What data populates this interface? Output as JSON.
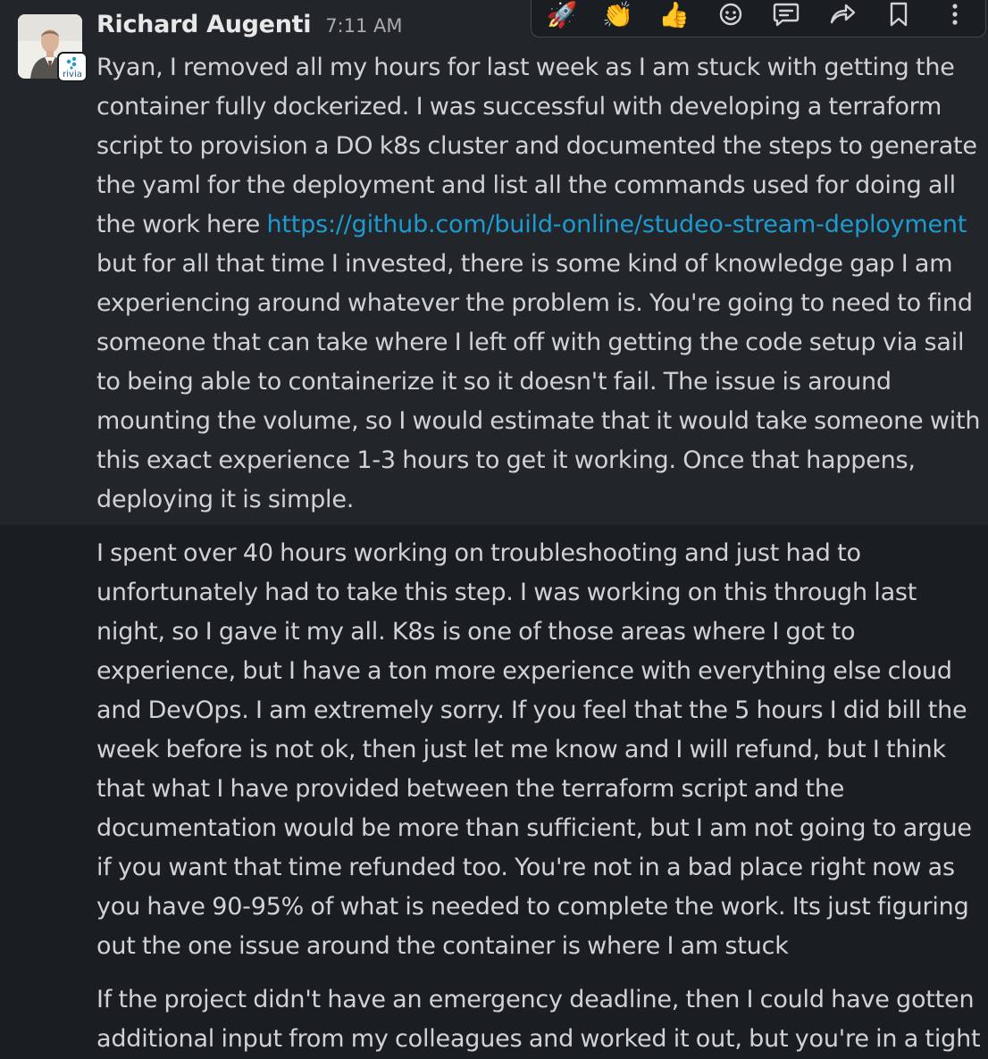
{
  "message": {
    "author": "Richard Augenti",
    "timestamp": "7:11 AM",
    "org_badge_label": "rivia",
    "paragraphs": [
      {
        "lines": [
          {
            "text": "Ryan, I removed all my hours for last week as I am stuck with getting the"
          },
          {
            "text": "container fully dockerized. I was successful with developing a terraform"
          },
          {
            "text": "script to provision a DO k8s cluster and documented the steps to generate"
          },
          {
            "text": "the yaml for the deployment and list all the commands used for doing all"
          },
          {
            "text": "the work here ",
            "link": "https://github.com/build-online/studeo-stream-deployment"
          },
          {
            "text": "but for all that time I invested, there is some kind of knowledge gap I am"
          },
          {
            "text": "experiencing around whatever the problem is. You're going to need to find"
          },
          {
            "text": "someone that can take where I left off with getting the code setup via sail"
          },
          {
            "text": "to being able to containerize it so it doesn't fail. The issue is around"
          },
          {
            "text": "mounting the volume, so I would estimate that it would take someone with"
          },
          {
            "text": "this exact experience 1-3 hours to get it working. Once that happens,"
          },
          {
            "text": "deploying it is simple."
          }
        ]
      },
      {
        "lines": [
          {
            "text": "I spent over 40 hours working on troubleshooting and just had to"
          },
          {
            "text": "unfortunately had to take this step. I was working on this through last"
          },
          {
            "text": "night, so I gave it my all. K8s is one of those areas where I got to"
          },
          {
            "text": "experience, but I have a ton more experience with everything else cloud"
          },
          {
            "text": "and DevOps. I am extremely sorry. If you feel that the 5 hours I did bill the"
          },
          {
            "text": "week before is not ok, then just let me know and I will refund, but I think"
          },
          {
            "text": "that what I have provided between the terraform script and the"
          },
          {
            "text": "documentation would be more than sufficient, but I am not going to argue"
          },
          {
            "text": "if you want that time refunded too. You're not in a bad place right now as"
          },
          {
            "text": "you have 90-95% of what is needed to complete the work. Its just figuring"
          },
          {
            "text": "out the one issue around the container is where I am stuck"
          }
        ]
      },
      {
        "lines": [
          {
            "text": "If the project didn't have an emergency deadline, then I could have gotten"
          },
          {
            "text": "additional input from my colleagues and worked it out, but you're in a tight"
          }
        ]
      }
    ]
  },
  "toolbar": {
    "items": [
      {
        "name": "rocket-emoji-reaction",
        "icon": "rocket-icon",
        "glyph": "🚀"
      },
      {
        "name": "clap-emoji-reaction",
        "icon": "clapping-hands-icon",
        "glyph": "👏"
      },
      {
        "name": "thumbs-up-emoji-reaction",
        "icon": "thumbs-up-icon",
        "glyph": "👍"
      },
      {
        "name": "add-reaction-button",
        "icon": "smiley-add-icon"
      },
      {
        "name": "reply-in-thread-button",
        "icon": "thread-bubble-icon"
      },
      {
        "name": "share-message-button",
        "icon": "forward-arrow-icon"
      },
      {
        "name": "save-for-later-button",
        "icon": "bookmark-icon"
      },
      {
        "name": "more-actions-button",
        "icon": "vertical-ellipsis-icon"
      }
    ]
  },
  "colors": {
    "background": "#1a1d21",
    "hover_background": "#222529",
    "text": "#d1d2d3",
    "author": "#e8e8e8",
    "timestamp": "#ababad",
    "link": "#1d9bd1",
    "toolbar_border": "#43464b"
  }
}
